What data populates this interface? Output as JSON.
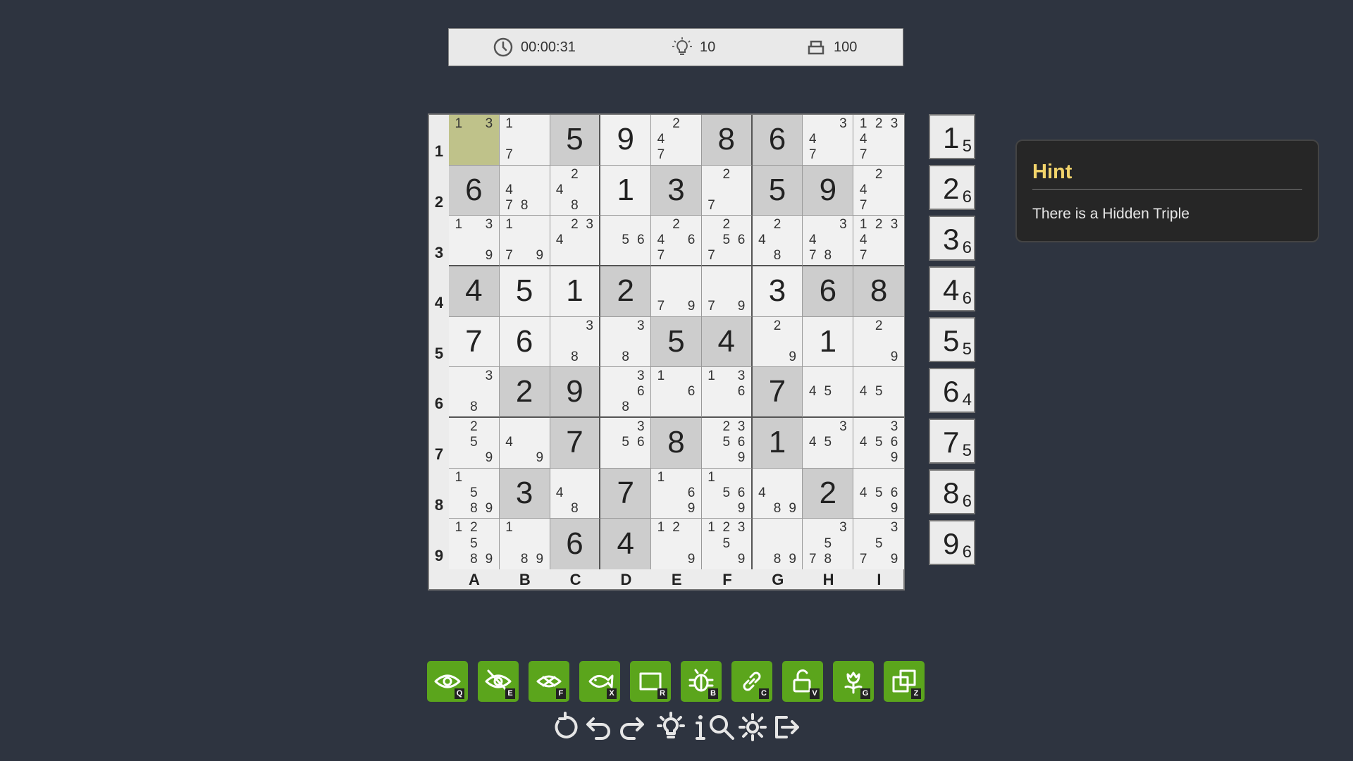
{
  "status": {
    "timer": "00:00:31",
    "hints": "10",
    "score": "100",
    "icons": [
      "clock-icon",
      "lightbulb-icon",
      "stack-icon"
    ]
  },
  "row_labels": [
    "1",
    "2",
    "3",
    "4",
    "5",
    "6",
    "7",
    "8",
    "9"
  ],
  "col_labels": [
    "A",
    "B",
    "C",
    "D",
    "E",
    "F",
    "G",
    "H",
    "I"
  ],
  "selected_cell": "A1",
  "grid": [
    [
      {
        "c": [
          1,
          3
        ]
      },
      {
        "c": [
          1,
          7
        ]
      },
      {
        "v": "5",
        "g": true
      },
      {
        "v": "9"
      },
      {
        "c": [
          2,
          4,
          7
        ]
      },
      {
        "v": "8",
        "g": true
      },
      {
        "v": "6",
        "g": true
      },
      {
        "c": [
          3,
          4,
          7
        ]
      },
      {
        "c": [
          1,
          2,
          3,
          4,
          7
        ]
      }
    ],
    [
      {
        "v": "6",
        "g": true
      },
      {
        "c": [
          4,
          7,
          8
        ]
      },
      {
        "c": [
          2,
          4,
          8
        ]
      },
      {
        "v": "1"
      },
      {
        "v": "3",
        "g": true
      },
      {
        "c": [
          2,
          7
        ]
      },
      {
        "v": "5",
        "g": true
      },
      {
        "v": "9",
        "g": true
      },
      {
        "c": [
          2,
          4,
          7
        ]
      }
    ],
    [
      {
        "c": [
          1,
          3,
          9
        ]
      },
      {
        "c": [
          1,
          7,
          9
        ]
      },
      {
        "c": [
          2,
          3,
          4
        ]
      },
      {
        "c": [
          5,
          6
        ]
      },
      {
        "c": [
          2,
          4,
          6,
          7
        ]
      },
      {
        "c": [
          2,
          5,
          6,
          7
        ]
      },
      {
        "c": [
          2,
          4,
          8
        ]
      },
      {
        "c": [
          3,
          4,
          7,
          8
        ]
      },
      {
        "c": [
          1,
          2,
          3,
          4,
          7
        ]
      }
    ],
    [
      {
        "v": "4",
        "g": true
      },
      {
        "v": "5"
      },
      {
        "v": "1"
      },
      {
        "v": "2",
        "g": true
      },
      {
        "c": [
          7,
          9
        ]
      },
      {
        "c": [
          7,
          9
        ]
      },
      {
        "v": "3"
      },
      {
        "v": "6",
        "g": true
      },
      {
        "v": "8",
        "g": true
      }
    ],
    [
      {
        "v": "7"
      },
      {
        "v": "6"
      },
      {
        "c": [
          3,
          8
        ]
      },
      {
        "c": [
          3,
          8
        ]
      },
      {
        "v": "5",
        "g": true
      },
      {
        "v": "4",
        "g": true
      },
      {
        "c": [
          2,
          9
        ]
      },
      {
        "v": "1"
      },
      {
        "c": [
          2,
          9
        ]
      }
    ],
    [
      {
        "c": [
          3,
          8
        ]
      },
      {
        "v": "2",
        "g": true
      },
      {
        "v": "9",
        "g": true
      },
      {
        "c": [
          3,
          6,
          8
        ]
      },
      {
        "c": [
          1,
          6
        ]
      },
      {
        "c": [
          1,
          3,
          6
        ]
      },
      {
        "v": "7",
        "g": true
      },
      {
        "c": [
          4,
          5
        ]
      },
      {
        "c": [
          4,
          5
        ]
      }
    ],
    [
      {
        "c": [
          2,
          5,
          9
        ]
      },
      {
        "c": [
          4,
          9
        ]
      },
      {
        "v": "7",
        "g": true
      },
      {
        "c": [
          3,
          5,
          6
        ]
      },
      {
        "v": "8",
        "g": true
      },
      {
        "c": [
          2,
          3,
          5,
          6,
          9
        ]
      },
      {
        "v": "1",
        "g": true
      },
      {
        "c": [
          3,
          4,
          5
        ]
      },
      {
        "c": [
          3,
          4,
          5,
          6,
          9
        ]
      }
    ],
    [
      {
        "c": [
          1,
          5,
          8,
          9
        ]
      },
      {
        "v": "3",
        "g": true
      },
      {
        "c": [
          4,
          8
        ]
      },
      {
        "v": "7",
        "g": true
      },
      {
        "c": [
          1,
          6,
          9
        ]
      },
      {
        "c": [
          1,
          5,
          6,
          9
        ]
      },
      {
        "c": [
          4,
          8,
          9
        ]
      },
      {
        "v": "2",
        "g": true
      },
      {
        "c": [
          4,
          5,
          6,
          9
        ]
      }
    ],
    [
      {
        "c": [
          1,
          2,
          5,
          8,
          9
        ]
      },
      {
        "c": [
          1,
          8,
          9
        ]
      },
      {
        "v": "6",
        "g": true
      },
      {
        "v": "4",
        "g": true
      },
      {
        "c": [
          1,
          2,
          9
        ]
      },
      {
        "c": [
          1,
          2,
          3,
          5,
          9
        ]
      },
      {
        "c": [
          8,
          9
        ]
      },
      {
        "c": [
          3,
          5,
          7,
          8
        ]
      },
      {
        "c": [
          3,
          5,
          7,
          9
        ]
      }
    ]
  ],
  "numpad": [
    {
      "n": "1",
      "count": "5"
    },
    {
      "n": "2",
      "count": "6"
    },
    {
      "n": "3",
      "count": "6"
    },
    {
      "n": "4",
      "count": "6"
    },
    {
      "n": "5",
      "count": "5"
    },
    {
      "n": "6",
      "count": "4"
    },
    {
      "n": "7",
      "count": "5"
    },
    {
      "n": "8",
      "count": "6"
    },
    {
      "n": "9",
      "count": "6"
    }
  ],
  "hint": {
    "title": "Hint",
    "text": "There is a Hidden Triple"
  },
  "tools": [
    {
      "icon": "eye-icon",
      "key": "Q"
    },
    {
      "icon": "eye-off-icon",
      "key": "E"
    },
    {
      "icon": "fish-eye-icon",
      "key": "F"
    },
    {
      "icon": "fish-icon",
      "key": "X"
    },
    {
      "icon": "rectangle-icon",
      "key": "R"
    },
    {
      "icon": "bug-icon",
      "key": "B"
    },
    {
      "icon": "chain-icon",
      "key": "C"
    },
    {
      "icon": "unlock-icon",
      "key": "V"
    },
    {
      "icon": "flower-icon",
      "key": "G"
    },
    {
      "icon": "copy-icon",
      "key": "Z"
    }
  ],
  "controls": [
    "restart-icon",
    "undo-icon",
    "redo-icon",
    "hint-bulb-icon",
    "info-icon",
    "search-icon",
    "settings-icon",
    "exit-icon"
  ],
  "colors": {
    "background": "#2e3440",
    "tool_green": "#5ba51c",
    "selected": "#bfc28a",
    "given": "#cdcdcd",
    "hint_title": "#f2d46b"
  }
}
